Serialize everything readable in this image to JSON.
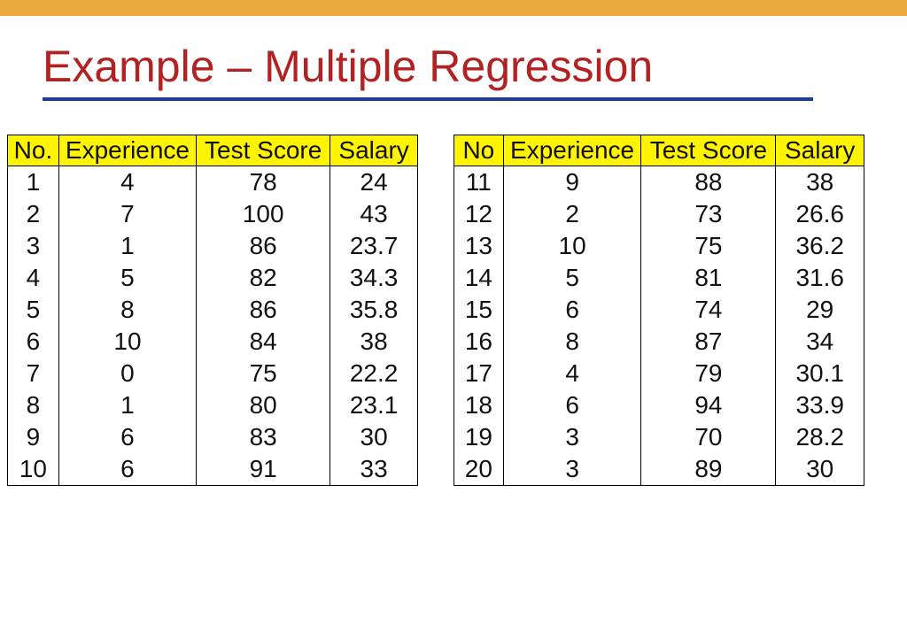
{
  "title": "Example – Multiple Regression",
  "table_left": {
    "headers": [
      "No.",
      "Experience",
      "Test Score",
      "Salary"
    ],
    "rows": [
      [
        "1",
        "4",
        "78",
        "24"
      ],
      [
        "2",
        "7",
        "100",
        "43"
      ],
      [
        "3",
        "1",
        "86",
        "23.7"
      ],
      [
        "4",
        "5",
        "82",
        "34.3"
      ],
      [
        "5",
        "8",
        "86",
        "35.8"
      ],
      [
        "6",
        "10",
        "84",
        "38"
      ],
      [
        "7",
        "0",
        "75",
        "22.2"
      ],
      [
        "8",
        "1",
        "80",
        "23.1"
      ],
      [
        "9",
        "6",
        "83",
        "30"
      ],
      [
        "10",
        "6",
        "91",
        "33"
      ]
    ]
  },
  "table_right": {
    "headers": [
      "No",
      "Experience",
      "Test Score",
      "Salary"
    ],
    "rows": [
      [
        "11",
        "9",
        "88",
        "38"
      ],
      [
        "12",
        "2",
        "73",
        "26.6"
      ],
      [
        "13",
        "10",
        "75",
        "36.2"
      ],
      [
        "14",
        "5",
        "81",
        "31.6"
      ],
      [
        "15",
        "6",
        "74",
        "29"
      ],
      [
        "16",
        "8",
        "87",
        "34"
      ],
      [
        "17",
        "4",
        "79",
        "30.1"
      ],
      [
        "18",
        "6",
        "94",
        "33.9"
      ],
      [
        "19",
        "3",
        "70",
        "28.2"
      ],
      [
        "20",
        "3",
        "89",
        "30"
      ]
    ]
  }
}
